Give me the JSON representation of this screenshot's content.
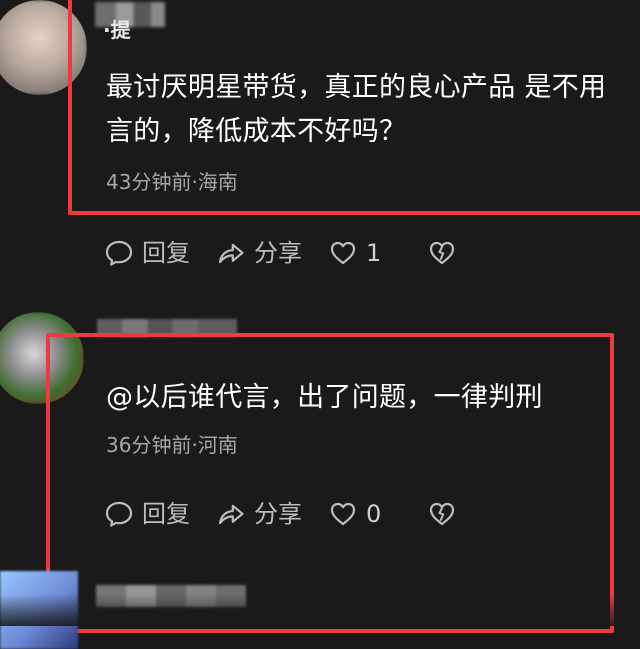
{
  "comments": [
    {
      "username": "·提",
      "content_line1": "最讨厌明星带货，真正的良心产品 是不用",
      "content_line2": "言的，降低成本不好吗？",
      "meta": "43分钟前·海南",
      "reply_label": "回复",
      "share_label": "分享",
      "like_count": "1"
    },
    {
      "username": "",
      "content_line1": "@以后谁代言，出了问题，一律判刑",
      "content_line2": "",
      "meta": "36分钟前·河南",
      "reply_label": "回复",
      "share_label": "分享",
      "like_count": "0"
    }
  ],
  "colors": {
    "background": "#1a1a1a",
    "highlight_border": "#ea3b43",
    "text_primary": "#ffffff",
    "text_secondary": "#a7a7a7",
    "icon": "#bdbdbd"
  },
  "icons": {
    "reply": "speech-bubble-icon",
    "share": "share-arrow-icon",
    "like": "heart-outline-icon",
    "dislike": "broken-heart-icon"
  }
}
